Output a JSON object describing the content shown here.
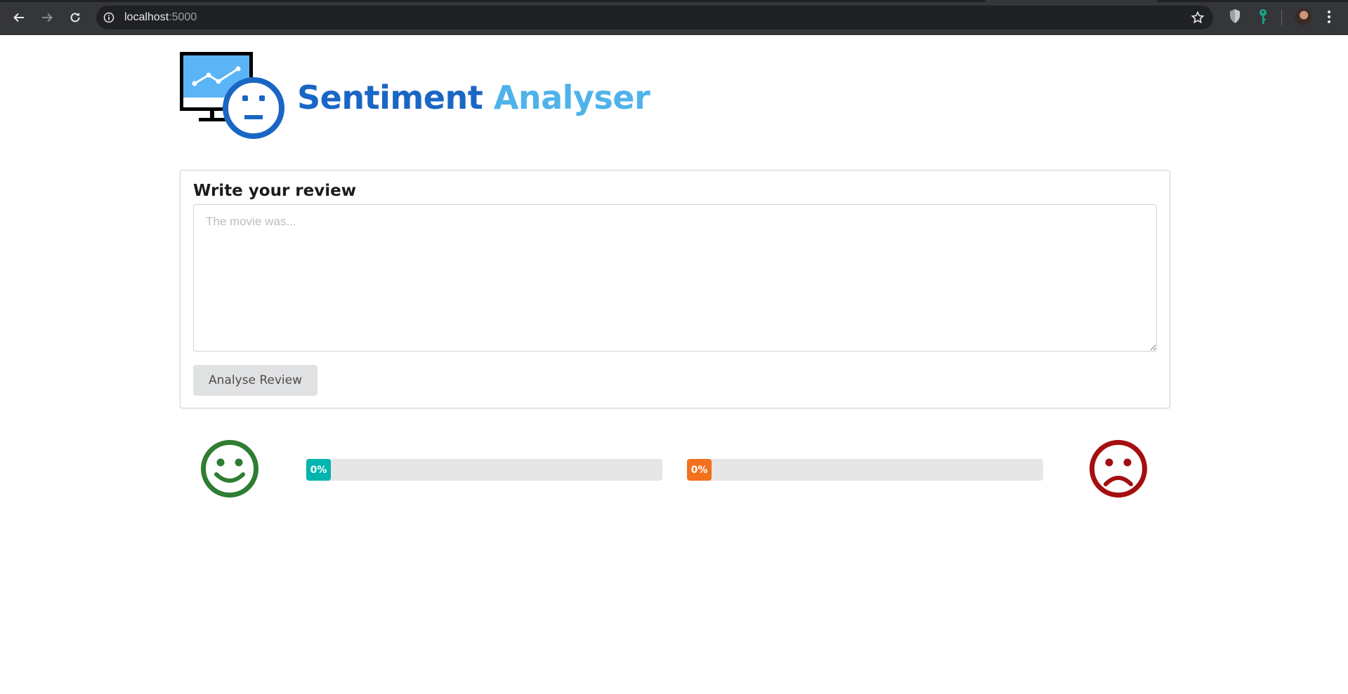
{
  "browser": {
    "url_host": "localhost",
    "url_port": ":5000"
  },
  "brand": {
    "word1": "Sentiment",
    "word2": "Analyser",
    "word1_color": "#1a66c4",
    "word2_color": "#4fb3ea"
  },
  "review_form": {
    "title": "Write your review",
    "textarea_value": "",
    "textarea_placeholder": "The movie was...",
    "submit_label": "Analyse Review"
  },
  "results": {
    "positive": {
      "icon": "smile-icon",
      "color": "#2e7d32",
      "percent": 0,
      "label": "0%",
      "bar_color": "#00b5ad"
    },
    "negative": {
      "icon": "frown-icon",
      "color": "#a50f0f",
      "percent": 0,
      "label": "0%",
      "bar_color": "#f2711c"
    }
  }
}
